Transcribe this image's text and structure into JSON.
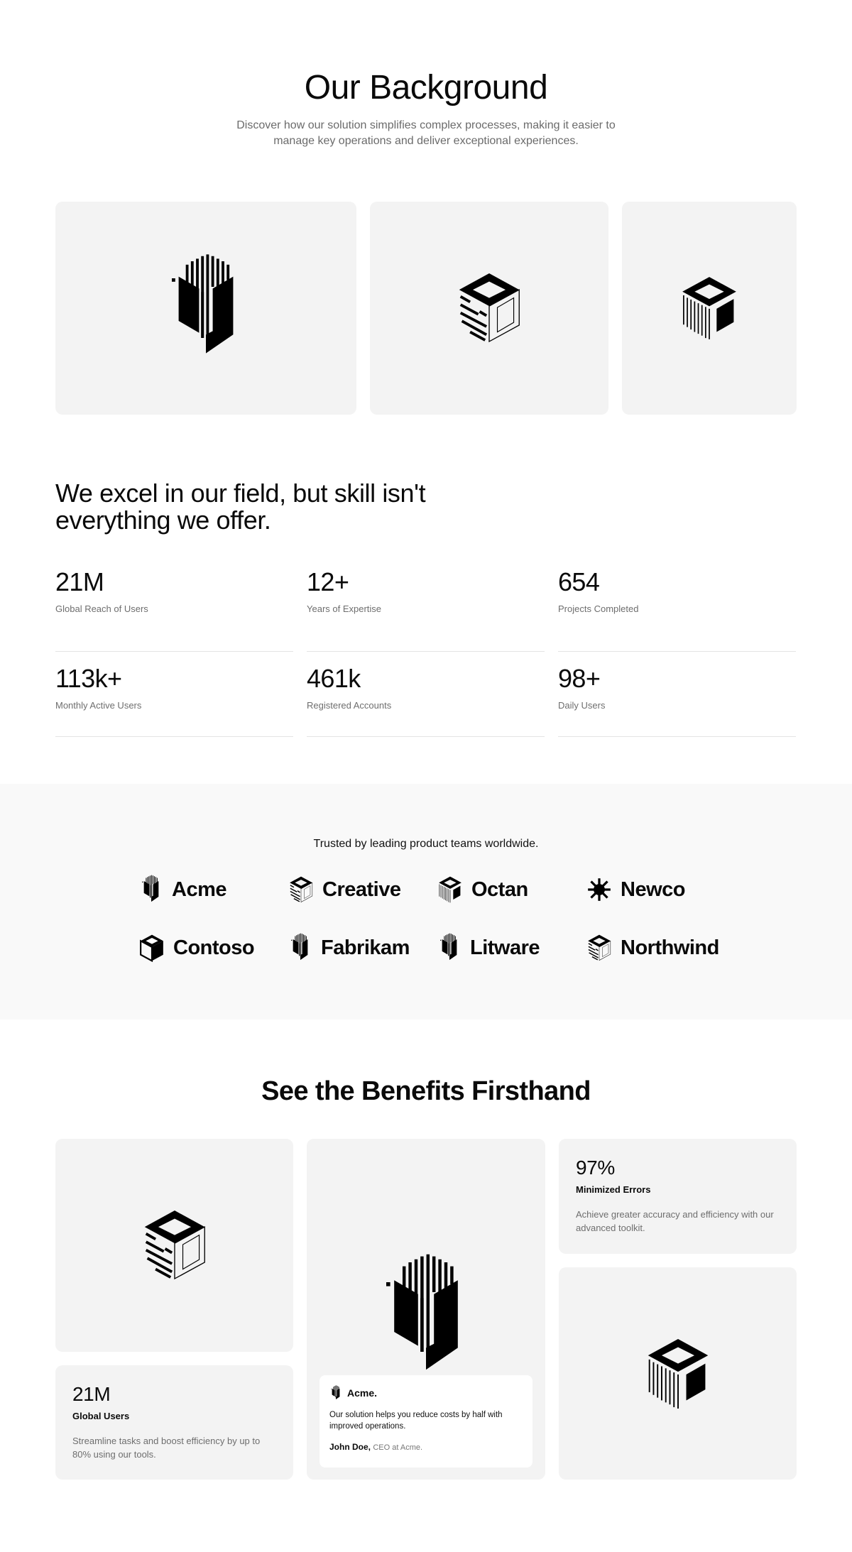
{
  "background": {
    "title": "Our Background",
    "subtitle": "Discover how our solution simplifies complex processes, making it easier to manage key operations and deliver exceptional experiences."
  },
  "excel": {
    "heading": "We excel in our field, but skill isn't everything we offer."
  },
  "stats": [
    {
      "value": "21M",
      "label": "Global Reach of Users"
    },
    {
      "value": "12+",
      "label": "Years of Expertise"
    },
    {
      "value": "654",
      "label": "Projects Completed"
    },
    {
      "value": "113k+",
      "label": "Monthly Active Users"
    },
    {
      "value": "461k",
      "label": "Registered Accounts"
    },
    {
      "value": "98+",
      "label": "Daily Users"
    }
  ],
  "trusted": {
    "title": "Trusted by leading product teams worldwide.",
    "logos": [
      {
        "name": "Acme",
        "icon": "shield-stripes-icon"
      },
      {
        "name": "Creative",
        "icon": "cube-outline-icon"
      },
      {
        "name": "Octan",
        "icon": "cube-lines-icon"
      },
      {
        "name": "Newco",
        "icon": "star-burst-icon"
      },
      {
        "name": "Contoso",
        "icon": "cube-solid-icon"
      },
      {
        "name": "Fabrikam",
        "icon": "shield-stripes-icon"
      },
      {
        "name": "Litware",
        "icon": "shield-stripes-icon"
      },
      {
        "name": "Northwind",
        "icon": "cube-outline-icon"
      }
    ]
  },
  "benefits": {
    "title": "See the Benefits Firsthand",
    "metric_left": {
      "value": "21M",
      "title": "Global Users",
      "description": "Streamline tasks and boost efficiency by up to 80% using our tools."
    },
    "metric_right": {
      "value": "97%",
      "title": "Minimized Errors",
      "description": "Achieve greater accuracy and efficiency with our advanced toolkit."
    },
    "testimonial": {
      "brand": "Acme.",
      "quote": "Our solution helps you reduce costs by half with improved operations.",
      "author": "John Doe,",
      "role": "CEO at Acme."
    }
  }
}
